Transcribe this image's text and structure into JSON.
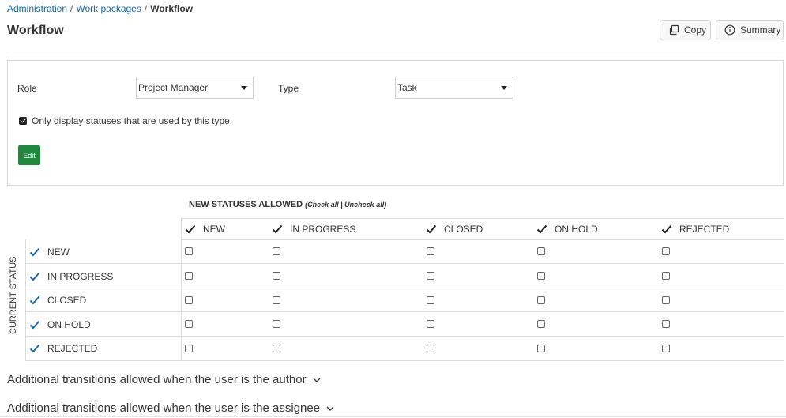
{
  "breadcrumb": {
    "items": [
      "Administration",
      "Work packages"
    ],
    "separator": "/",
    "current": "Workflow"
  },
  "page": {
    "title": "Workflow"
  },
  "toolbar": {
    "copy_label": "Copy",
    "copy_icon": "copy-icon",
    "summary_label": "Summary",
    "summary_icon": "info-icon"
  },
  "filters": {
    "role_label": "Role",
    "role_value": "Project Manager",
    "type_label": "Type",
    "type_value": "Task",
    "only_used_label": "Only display statuses that are used by this type",
    "only_used_checked": true,
    "edit_label": "Edit"
  },
  "matrix": {
    "new_statuses_label": "NEW STATUSES ALLOWED",
    "check_all": "Check all",
    "links_separator": "|",
    "uncheck_all": "Uncheck all",
    "current_status_label": "CURRENT STATUS",
    "columns": [
      "NEW",
      "IN PROGRESS",
      "CLOSED",
      "ON HOLD",
      "REJECTED"
    ],
    "rows": [
      "NEW",
      "IN PROGRESS",
      "CLOSED",
      "ON HOLD",
      "REJECTED"
    ],
    "check_icon": "checkmark-icon"
  },
  "sections": {
    "author": "Additional transitions allowed when the user is the author",
    "assignee": "Additional transitions allowed when the user is the assignee"
  },
  "colors": {
    "link": "#1a67a3",
    "check": "#1a67a3",
    "edit_button": "#1f883d",
    "border": "#dddddd"
  }
}
